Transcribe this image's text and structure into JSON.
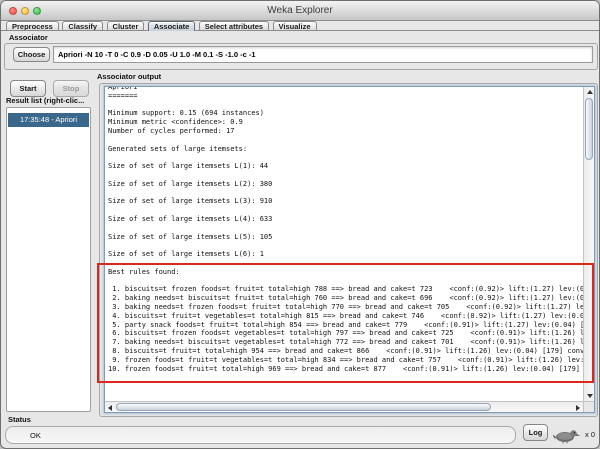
{
  "window": {
    "title": "Weka Explorer"
  },
  "tabs": {
    "items": [
      "Preprocess",
      "Classify",
      "Cluster",
      "Associate",
      "Select attributes",
      "Visualize"
    ],
    "active": "Associate"
  },
  "associator": {
    "section_label": "Associator",
    "choose_label": "Choose",
    "config_value": "Apriori -N 10 -T 0 -C 0.9 -D 0.05 -U 1.0 -M 0.1 -S -1.0 -c -1"
  },
  "controls": {
    "start_label": "Start",
    "stop_label": "Stop"
  },
  "result_list": {
    "label": "Result list (right-clic...",
    "selected_item": "17:35:48 - Apriori"
  },
  "output": {
    "label": "Associator output",
    "text": "Apriori\n=======\n\nMinimum support: 0.15 (694 instances)\nMinimum metric <confidence>: 0.9\nNumber of cycles performed: 17\n\nGenerated sets of large itemsets:\n\nSize of set of large itemsets L(1): 44\n\nSize of set of large itemsets L(2): 380\n\nSize of set of large itemsets L(3): 910\n\nSize of set of large itemsets L(4): 633\n\nSize of set of large itemsets L(5): 105\n\nSize of set of large itemsets L(6): 1\n\nBest rules found:\n\n 1. biscuits=t frozen foods=t fruit=t total=high 788 ==> bread and cake=t 723    <conf:(0.92)> lift:(1.27) lev:(0.03\n 2. baking needs=t biscuits=t fruit=t total=high 760 ==> bread and cake=t 696    <conf:(0.92)> lift:(1.27) lev:(0.03\n 3. baking needs=t frozen foods=t fruit=t total=high 770 ==> bread and cake=t 705    <conf:(0.92)> lift:(1.27) lev:(0\n 4. biscuits=t fruit=t vegetables=t total=high 815 ==> bread and cake=t 746    <conf:(0.92)> lift:(1.27) lev:(0.03) [\n 5. party snack foods=t fruit=t total=high 854 ==> bread and cake=t 779    <conf:(0.91)> lift:(1.27) lev:(0.04) [164]\n 6. biscuits=t frozen foods=t vegetables=t total=high 797 ==> bread and cake=t 725    <conf:(0.91)> lift:(1.26) lev:(\n 7. baking needs=t biscuits=t vegetables=t total=high 772 ==> bread and cake=t 701    <conf:(0.91)> lift:(1.26) lev:(\n 8. biscuits=t fruit=t total=high 954 ==> bread and cake=t 866    <conf:(0.91)> lift:(1.26) lev:(0.04) [179] conv:(3\n 9. frozen foods=t fruit=t vegetables=t total=high 834 ==> bread and cake=t 757    <conf:(0.91)> lift:(1.26) lev:(0.\n10. frozen foods=t fruit=t total=high 969 ==> bread and cake=t 877    <conf:(0.91)> lift:(1.26) lev:(0.04) [179] conv"
  },
  "status": {
    "label": "Status",
    "value": "OK",
    "log_label": "Log",
    "bird_count": "x 0"
  },
  "colors": {
    "selection_blue": "#3a688c",
    "annotation_red": "#da291c",
    "focus_ring_blue": "#7f9db9"
  }
}
